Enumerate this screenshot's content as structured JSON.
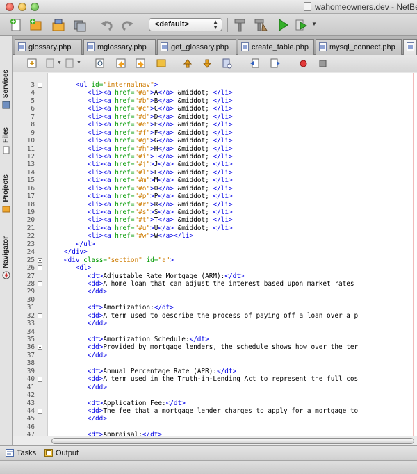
{
  "window": {
    "title": "wahomeowners.dev - NetBea"
  },
  "toolbar": {
    "config_value": "<default>"
  },
  "left_dock": {
    "tabs": [
      "Services",
      "Files",
      "Projects",
      "Navigator"
    ]
  },
  "editor_tabs": [
    "glossary.php",
    "mglossary.php",
    "get_glossary.php",
    "create_table.php",
    "mysql_connect.php",
    "g"
  ],
  "bottom_tabs": [
    "Tasks",
    "Output"
  ],
  "colors": {
    "tag": "#0000e6",
    "attribute": "#009900",
    "value": "#ce7b00",
    "text": "#000000"
  },
  "code": {
    "lines": [
      {
        "n": "3",
        "fold": true,
        "indent": 6,
        "tokens": [
          [
            "tag",
            "<ul "
          ],
          [
            "attr",
            "id="
          ],
          [
            "val",
            "\"internalnav\""
          ],
          [
            "tag",
            ">"
          ]
        ]
      },
      {
        "n": "4",
        "indent": 9,
        "tokens": [
          [
            "tag",
            "<li><a "
          ],
          [
            "attr",
            "href="
          ],
          [
            "val",
            "\"#a\""
          ],
          [
            "tag",
            ">"
          ],
          [
            "txt",
            "A"
          ],
          [
            "tag",
            "</a>"
          ],
          [
            "txt",
            " &middot; "
          ],
          [
            "tag",
            "</li>"
          ]
        ]
      },
      {
        "n": "5",
        "indent": 9,
        "tokens": [
          [
            "tag",
            "<li><a "
          ],
          [
            "attr",
            "href="
          ],
          [
            "val",
            "\"#b\""
          ],
          [
            "tag",
            ">"
          ],
          [
            "txt",
            "B"
          ],
          [
            "tag",
            "</a>"
          ],
          [
            "txt",
            " &middot; "
          ],
          [
            "tag",
            "</li>"
          ]
        ]
      },
      {
        "n": "6",
        "indent": 9,
        "tokens": [
          [
            "tag",
            "<li><a "
          ],
          [
            "attr",
            "href="
          ],
          [
            "val",
            "\"#c\""
          ],
          [
            "tag",
            ">"
          ],
          [
            "txt",
            "C"
          ],
          [
            "tag",
            "</a>"
          ],
          [
            "txt",
            " &middot; "
          ],
          [
            "tag",
            "</li>"
          ]
        ]
      },
      {
        "n": "7",
        "indent": 9,
        "tokens": [
          [
            "tag",
            "<li><a "
          ],
          [
            "attr",
            "href="
          ],
          [
            "val",
            "\"#d\""
          ],
          [
            "tag",
            ">"
          ],
          [
            "txt",
            "D"
          ],
          [
            "tag",
            "</a>"
          ],
          [
            "txt",
            " &middot; "
          ],
          [
            "tag",
            "</li>"
          ]
        ]
      },
      {
        "n": "8",
        "indent": 9,
        "tokens": [
          [
            "tag",
            "<li><a "
          ],
          [
            "attr",
            "href="
          ],
          [
            "val",
            "\"#e\""
          ],
          [
            "tag",
            ">"
          ],
          [
            "txt",
            "E"
          ],
          [
            "tag",
            "</a>"
          ],
          [
            "txt",
            " &middot; "
          ],
          [
            "tag",
            "</li>"
          ]
        ]
      },
      {
        "n": "9",
        "indent": 9,
        "tokens": [
          [
            "tag",
            "<li><a "
          ],
          [
            "attr",
            "href="
          ],
          [
            "val",
            "\"#f\""
          ],
          [
            "tag",
            ">"
          ],
          [
            "txt",
            "F"
          ],
          [
            "tag",
            "</a>"
          ],
          [
            "txt",
            " &middot; "
          ],
          [
            "tag",
            "</li>"
          ]
        ]
      },
      {
        "n": "10",
        "indent": 9,
        "tokens": [
          [
            "tag",
            "<li><a "
          ],
          [
            "attr",
            "href="
          ],
          [
            "val",
            "\"#g\""
          ],
          [
            "tag",
            ">"
          ],
          [
            "txt",
            "G"
          ],
          [
            "tag",
            "</a>"
          ],
          [
            "txt",
            " &middot; "
          ],
          [
            "tag",
            "</li>"
          ]
        ]
      },
      {
        "n": "11",
        "indent": 9,
        "tokens": [
          [
            "tag",
            "<li><a "
          ],
          [
            "attr",
            "href="
          ],
          [
            "val",
            "\"#h\""
          ],
          [
            "tag",
            ">"
          ],
          [
            "txt",
            "H"
          ],
          [
            "tag",
            "</a>"
          ],
          [
            "txt",
            " &middot; "
          ],
          [
            "tag",
            "</li>"
          ]
        ]
      },
      {
        "n": "12",
        "indent": 9,
        "tokens": [
          [
            "tag",
            "<li><a "
          ],
          [
            "attr",
            "href="
          ],
          [
            "val",
            "\"#i\""
          ],
          [
            "tag",
            ">"
          ],
          [
            "txt",
            "I"
          ],
          [
            "tag",
            "</a>"
          ],
          [
            "txt",
            " &middot; "
          ],
          [
            "tag",
            "</li>"
          ]
        ]
      },
      {
        "n": "13",
        "indent": 9,
        "tokens": [
          [
            "tag",
            "<li><a "
          ],
          [
            "attr",
            "href="
          ],
          [
            "val",
            "\"#j\""
          ],
          [
            "tag",
            ">"
          ],
          [
            "txt",
            "J"
          ],
          [
            "tag",
            "</a>"
          ],
          [
            "txt",
            " &middot; "
          ],
          [
            "tag",
            "</li>"
          ]
        ]
      },
      {
        "n": "14",
        "indent": 9,
        "tokens": [
          [
            "tag",
            "<li><a "
          ],
          [
            "attr",
            "href="
          ],
          [
            "val",
            "\"#l\""
          ],
          [
            "tag",
            ">"
          ],
          [
            "txt",
            "L"
          ],
          [
            "tag",
            "</a>"
          ],
          [
            "txt",
            " &middot; "
          ],
          [
            "tag",
            "</li>"
          ]
        ]
      },
      {
        "n": "15",
        "indent": 9,
        "tokens": [
          [
            "tag",
            "<li><a "
          ],
          [
            "attr",
            "href="
          ],
          [
            "val",
            "\"#m\""
          ],
          [
            "tag",
            ">"
          ],
          [
            "txt",
            "M"
          ],
          [
            "tag",
            "</a>"
          ],
          [
            "txt",
            " &middot; "
          ],
          [
            "tag",
            "</li>"
          ]
        ]
      },
      {
        "n": "16",
        "indent": 9,
        "tokens": [
          [
            "tag",
            "<li><a "
          ],
          [
            "attr",
            "href="
          ],
          [
            "val",
            "\"#o\""
          ],
          [
            "tag",
            ">"
          ],
          [
            "txt",
            "O"
          ],
          [
            "tag",
            "</a>"
          ],
          [
            "txt",
            " &middot; "
          ],
          [
            "tag",
            "</li>"
          ]
        ]
      },
      {
        "n": "17",
        "indent": 9,
        "tokens": [
          [
            "tag",
            "<li><a "
          ],
          [
            "attr",
            "href="
          ],
          [
            "val",
            "\"#p\""
          ],
          [
            "tag",
            ">"
          ],
          [
            "txt",
            "P"
          ],
          [
            "tag",
            "</a>"
          ],
          [
            "txt",
            " &middot; "
          ],
          [
            "tag",
            "</li>"
          ]
        ]
      },
      {
        "n": "18",
        "indent": 9,
        "tokens": [
          [
            "tag",
            "<li><a "
          ],
          [
            "attr",
            "href="
          ],
          [
            "val",
            "\"#r\""
          ],
          [
            "tag",
            ">"
          ],
          [
            "txt",
            "R"
          ],
          [
            "tag",
            "</a>"
          ],
          [
            "txt",
            " &middot; "
          ],
          [
            "tag",
            "</li>"
          ]
        ]
      },
      {
        "n": "19",
        "indent": 9,
        "tokens": [
          [
            "tag",
            "<li><a "
          ],
          [
            "attr",
            "href="
          ],
          [
            "val",
            "\"#s\""
          ],
          [
            "tag",
            ">"
          ],
          [
            "txt",
            "S"
          ],
          [
            "tag",
            "</a>"
          ],
          [
            "txt",
            " &middot; "
          ],
          [
            "tag",
            "</li>"
          ]
        ]
      },
      {
        "n": "20",
        "indent": 9,
        "tokens": [
          [
            "tag",
            "<li><a "
          ],
          [
            "attr",
            "href="
          ],
          [
            "val",
            "\"#t\""
          ],
          [
            "tag",
            ">"
          ],
          [
            "txt",
            "T"
          ],
          [
            "tag",
            "</a>"
          ],
          [
            "txt",
            " &middot; "
          ],
          [
            "tag",
            "</li>"
          ]
        ]
      },
      {
        "n": "21",
        "indent": 9,
        "tokens": [
          [
            "tag",
            "<li><a "
          ],
          [
            "attr",
            "href="
          ],
          [
            "val",
            "\"#u\""
          ],
          [
            "tag",
            ">"
          ],
          [
            "txt",
            "U"
          ],
          [
            "tag",
            "</a>"
          ],
          [
            "txt",
            " &middot; "
          ],
          [
            "tag",
            "</li>"
          ]
        ]
      },
      {
        "n": "22",
        "indent": 9,
        "tokens": [
          [
            "tag",
            "<li><a "
          ],
          [
            "attr",
            "href="
          ],
          [
            "val",
            "\"#w\""
          ],
          [
            "tag",
            ">"
          ],
          [
            "txt",
            "W"
          ],
          [
            "tag",
            "</a></li>"
          ]
        ]
      },
      {
        "n": "23",
        "indent": 6,
        "tokens": [
          [
            "tag",
            "</ul>"
          ]
        ]
      },
      {
        "n": "24",
        "indent": 3,
        "tokens": [
          [
            "tag",
            "</div>"
          ]
        ]
      },
      {
        "n": "25",
        "fold": true,
        "indent": 3,
        "tokens": [
          [
            "tag",
            "<div "
          ],
          [
            "attr",
            "class="
          ],
          [
            "val",
            "\"section\""
          ],
          [
            "txt",
            " "
          ],
          [
            "attr",
            "id="
          ],
          [
            "val",
            "\"a\""
          ],
          [
            "tag",
            ">"
          ]
        ]
      },
      {
        "n": "26",
        "fold": true,
        "indent": 6,
        "tokens": [
          [
            "tag",
            "<dl>"
          ]
        ]
      },
      {
        "n": "27",
        "indent": 9,
        "tokens": [
          [
            "tag",
            "<dt>"
          ],
          [
            "txt",
            "Adjustable Rate Mortgage (ARM):"
          ],
          [
            "tag",
            "</dt>"
          ]
        ]
      },
      {
        "n": "28",
        "fold": true,
        "indent": 9,
        "tokens": [
          [
            "tag",
            "<dd>"
          ],
          [
            "txt",
            "A home loan that can adjust the interest based upon market rates"
          ]
        ]
      },
      {
        "n": "29",
        "indent": 9,
        "tokens": [
          [
            "tag",
            "</dd>"
          ]
        ]
      },
      {
        "n": "30",
        "indent": 0,
        "tokens": []
      },
      {
        "n": "31",
        "indent": 9,
        "tokens": [
          [
            "tag",
            "<dt>"
          ],
          [
            "txt",
            "Amortization:"
          ],
          [
            "tag",
            "</dt>"
          ]
        ]
      },
      {
        "n": "32",
        "fold": true,
        "indent": 9,
        "tokens": [
          [
            "tag",
            "<dd>"
          ],
          [
            "txt",
            "A term used to describe the process of paying off a loan over a p"
          ]
        ]
      },
      {
        "n": "33",
        "indent": 9,
        "tokens": [
          [
            "tag",
            "</dd>"
          ]
        ]
      },
      {
        "n": "34",
        "indent": 0,
        "tokens": []
      },
      {
        "n": "35",
        "indent": 9,
        "tokens": [
          [
            "tag",
            "<dt>"
          ],
          [
            "txt",
            "Amortization Schedule:"
          ],
          [
            "tag",
            "</dt>"
          ]
        ]
      },
      {
        "n": "36",
        "fold": true,
        "indent": 9,
        "tokens": [
          [
            "tag",
            "<dd>"
          ],
          [
            "txt",
            "Provided by mortgage lenders, the schedule shows how over the ter"
          ]
        ]
      },
      {
        "n": "37",
        "indent": 9,
        "tokens": [
          [
            "tag",
            "</dd>"
          ]
        ]
      },
      {
        "n": "38",
        "indent": 0,
        "tokens": []
      },
      {
        "n": "39",
        "indent": 9,
        "tokens": [
          [
            "tag",
            "<dt>"
          ],
          [
            "txt",
            "Annual Percentage Rate (APR):"
          ],
          [
            "tag",
            "</dt>"
          ]
        ]
      },
      {
        "n": "40",
        "fold": true,
        "indent": 9,
        "tokens": [
          [
            "tag",
            "<dd>"
          ],
          [
            "txt",
            "A term used in the Truth-in-Lending Act to represent the full cos"
          ]
        ]
      },
      {
        "n": "41",
        "indent": 9,
        "tokens": [
          [
            "tag",
            "</dd>"
          ]
        ]
      },
      {
        "n": "42",
        "indent": 0,
        "tokens": []
      },
      {
        "n": "43",
        "indent": 9,
        "tokens": [
          [
            "tag",
            "<dt>"
          ],
          [
            "txt",
            "Application Fee:"
          ],
          [
            "tag",
            "</dt>"
          ]
        ]
      },
      {
        "n": "44",
        "fold": true,
        "indent": 9,
        "tokens": [
          [
            "tag",
            "<dd>"
          ],
          [
            "txt",
            "The fee that a mortgage lender charges to apply for a mortgage to"
          ]
        ]
      },
      {
        "n": "45",
        "indent": 9,
        "tokens": [
          [
            "tag",
            "</dd>"
          ]
        ]
      },
      {
        "n": "46",
        "indent": 0,
        "tokens": []
      },
      {
        "n": "47",
        "indent": 9,
        "tokens": [
          [
            "tag",
            "<dt>"
          ],
          [
            "txt",
            "Appraisal:"
          ],
          [
            "tag",
            "</dt>"
          ]
        ]
      }
    ]
  }
}
